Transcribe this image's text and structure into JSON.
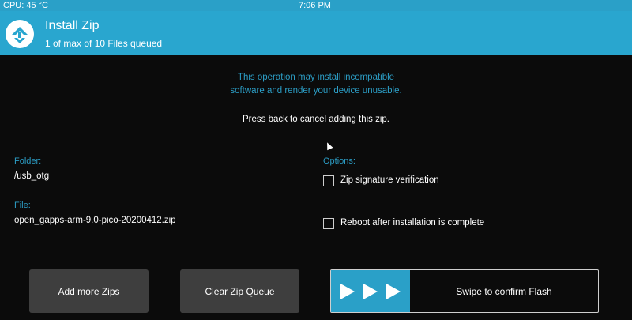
{
  "status_bar": {
    "cpu": "CPU: 45 °C",
    "time": "7:06 PM"
  },
  "header": {
    "title": "Install Zip",
    "subtitle": "1 of max of 10 Files queued"
  },
  "warning": {
    "line1": "This operation may install incompatible",
    "line2": "software and render your device unusable."
  },
  "back_note": "Press back to cancel adding this zip.",
  "folder": {
    "label": "Folder:",
    "value": "/usb_otg"
  },
  "file": {
    "label": "File:",
    "value": "open_gapps-arm-9.0-pico-20200412.zip"
  },
  "options": {
    "label": "Options:",
    "items": [
      {
        "label": "Zip signature verification",
        "checked": false
      },
      {
        "label": "Reboot after installation is complete",
        "checked": false
      }
    ]
  },
  "buttons": {
    "add_more": "Add more Zips",
    "clear_queue": "Clear Zip Queue"
  },
  "swipe": {
    "label": "Swipe to confirm Flash"
  },
  "colors": {
    "accent": "#29a6cf",
    "background": "#0b0b0b",
    "button": "#3e3e3e"
  }
}
